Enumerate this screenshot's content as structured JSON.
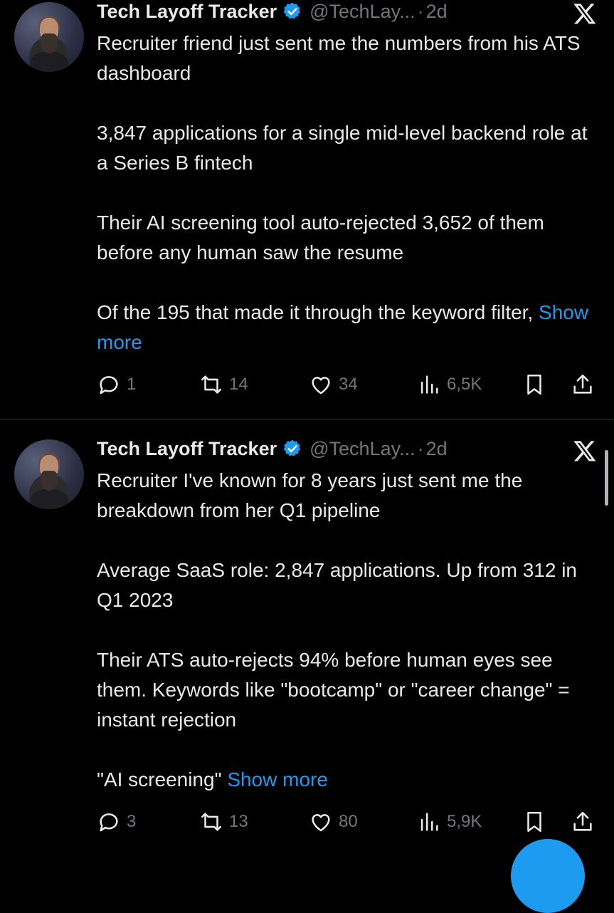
{
  "tweets": [
    {
      "author": "Tech Layoff Tracker",
      "handle": "@TechLay...",
      "separator": "·",
      "time": "2d",
      "lines": [
        "Recruiter friend just sent me the numbers from his ATS dashboard",
        "",
        "3,847 applications for a single mid-level backend role at a Series B fintech",
        "",
        "Their AI screening tool auto-rejected 3,652 of them before any human saw the resume",
        "",
        "Of the 195 that made it through the keyword filter,"
      ],
      "show_more": "Show more",
      "replies": "1",
      "retweets": "14",
      "likes": "34",
      "views": "6,5K"
    },
    {
      "author": "Tech Layoff Tracker",
      "handle": "@TechLay...",
      "separator": "·",
      "time": "2d",
      "lines": [
        "Recruiter I've known for 8 years just sent me the breakdown from her Q1 pipeline",
        "",
        "Average SaaS role: 2,847 applications. Up from 312 in Q1 2023",
        "",
        "Their ATS auto-rejects 94% before human eyes see them. Keywords like \"bootcamp\" or \"career change\" = instant rejection",
        "",
        "\"AI screening\""
      ],
      "show_more": "Show more",
      "replies": "3",
      "retweets": "13",
      "likes": "80",
      "views": "5,9K"
    }
  ],
  "icons": {
    "reply": "reply-icon",
    "retweet": "retweet-icon",
    "like": "heart-icon",
    "views": "views-icon",
    "bookmark": "bookmark-icon",
    "share": "share-icon",
    "verified": "verified-badge-icon",
    "x": "x-logo-icon"
  },
  "colors": {
    "background": "#000000",
    "text": "#e7e9ea",
    "muted": "#71767b",
    "accent": "#1d9bf0"
  }
}
